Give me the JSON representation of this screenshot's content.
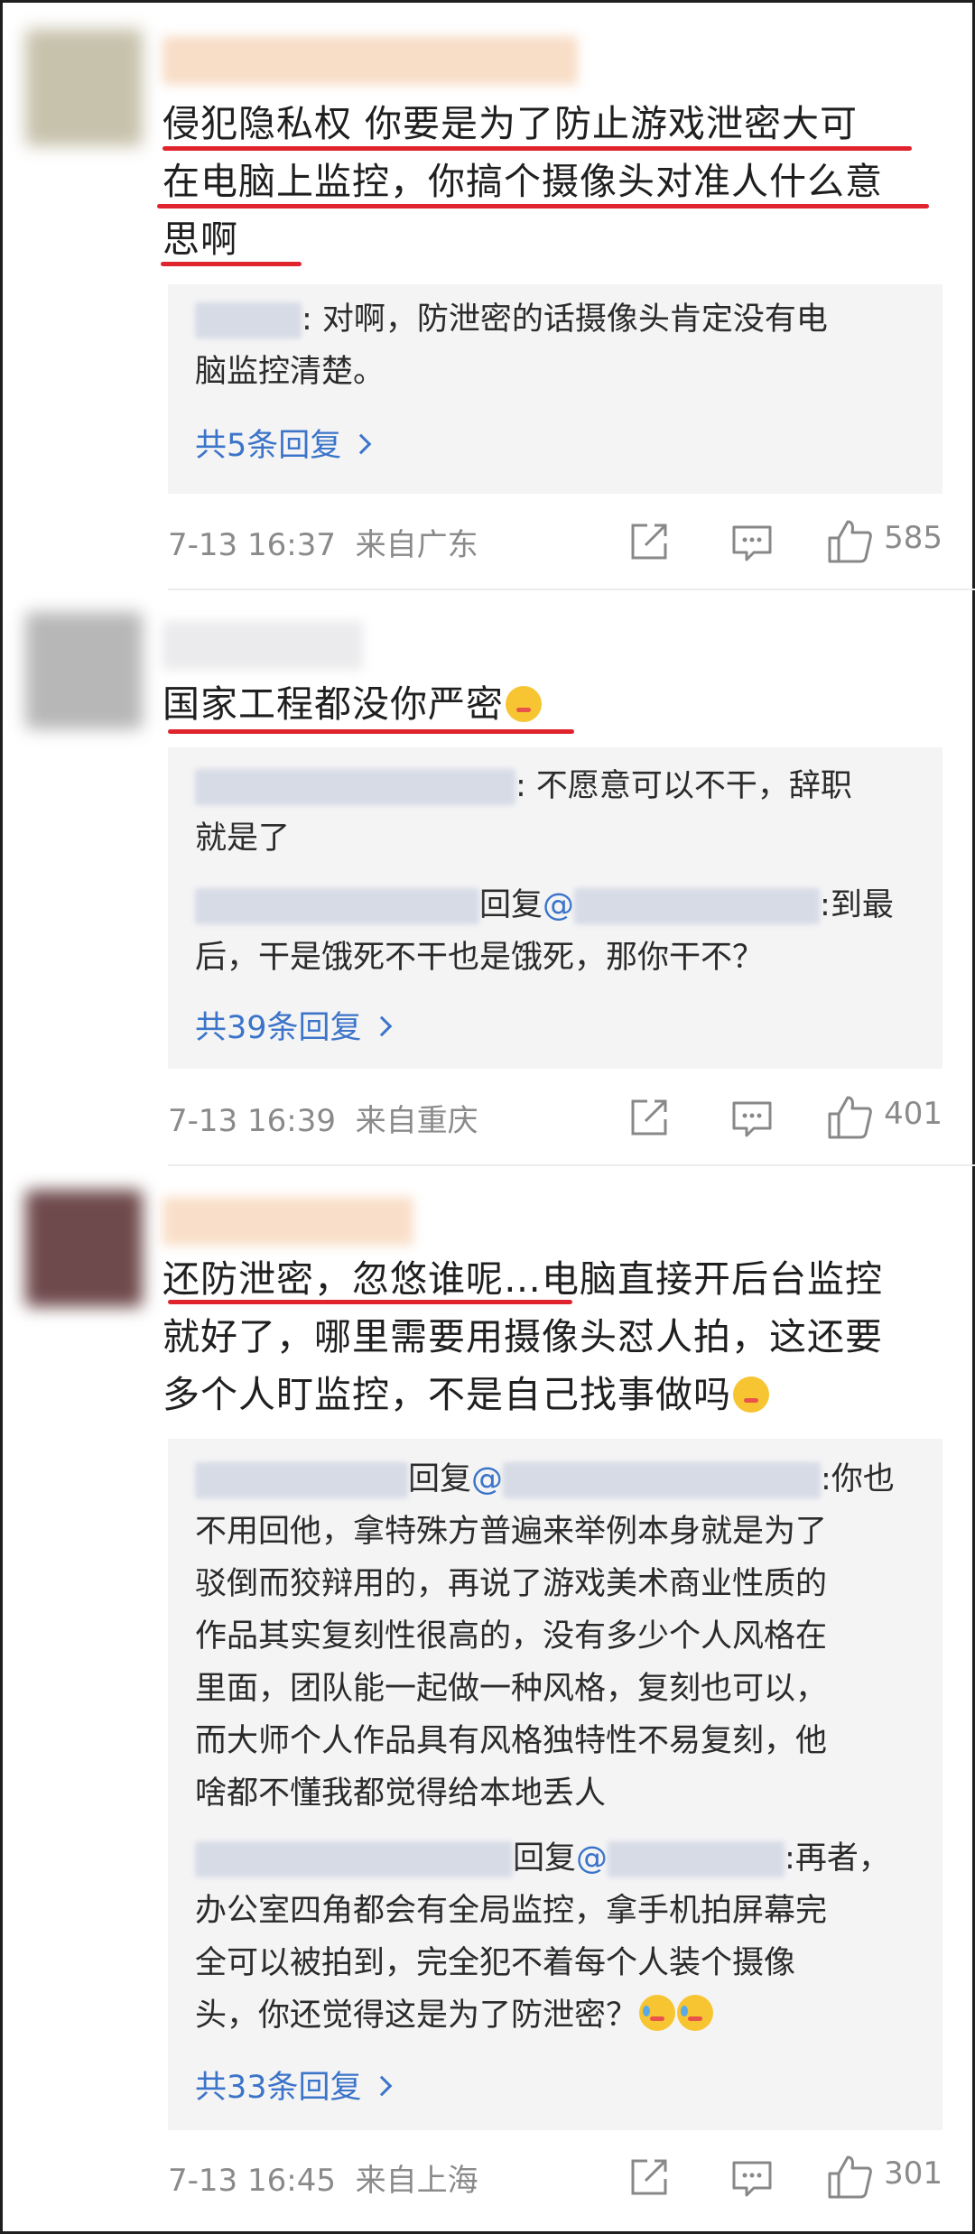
{
  "comments": [
    {
      "text_lines": [
        "侵犯隐私权 你要是为了防止游戏泄密大可",
        "在电脑上监控，你搞个摄像头对准人什么意",
        "思啊"
      ],
      "replies": [
        {
          "sep": ": ",
          "text1": "对啊，防泄密的话摄像头肯定没有电",
          "text2": "脑监控清楚。"
        }
      ],
      "more": "共5条回复",
      "time": "7-13 16:37",
      "location": "来自广东",
      "likes": "585"
    },
    {
      "text_lines": [
        "国家工程都没你严密"
      ],
      "replies": [
        {
          "sep": ": ",
          "text1": "不愿意可以不干，辞职",
          "text2": "就是了"
        },
        {
          "reply_word": "回复",
          "at": "@",
          "sep": ":",
          "text1": "到最",
          "text2": "后，干是饿死不干也是饿死，那你干不？"
        }
      ],
      "more": "共39条回复",
      "time": "7-13 16:39",
      "location": "来自重庆",
      "likes": "401"
    },
    {
      "text_lines": [
        "还防泄密，忽悠谁呢…电脑直接开后台监控",
        "就好了，哪里需要用摄像头怼人拍，这还要",
        "多个人盯监控，不是自己找事做吗"
      ],
      "replies": [
        {
          "reply_word": "回复",
          "at": "@",
          "sep": ":",
          "text1": "你也",
          "lines": [
            "不用回他，拿特殊方普遍来举例本身就是为了",
            "驳倒而狡辩用的，再说了游戏美术商业性质的",
            "作品其实复刻性很高的，没有多少个人风格在",
            "里面，团队能一起做一种风格，复刻也可以，",
            "而大师个人作品具有风格独特性不易复刻，他",
            "啥都不懂我都觉得给本地丢人"
          ]
        },
        {
          "reply_word": "回复",
          "at": "@",
          "sep": ":",
          "text1": "再者，",
          "lines": [
            "办公室四角都会有全局监控，拿手机拍屏幕完",
            "全可以被拍到，完全犯不着每个人装个摄像",
            "头，你还觉得这是为了防泄密？"
          ]
        }
      ],
      "more": "共33条回复",
      "time": "7-13 16:45",
      "location": "来自上海",
      "likes": "301"
    }
  ],
  "colors": {
    "accent_blue": "#3b74c9",
    "underline_red": "#e0242e",
    "meta_gray": "#8a8a8a",
    "reply_bg": "#f4f4f5"
  },
  "icons": [
    "share-icon",
    "comment-icon",
    "like-icon",
    "chevron-right-icon"
  ]
}
